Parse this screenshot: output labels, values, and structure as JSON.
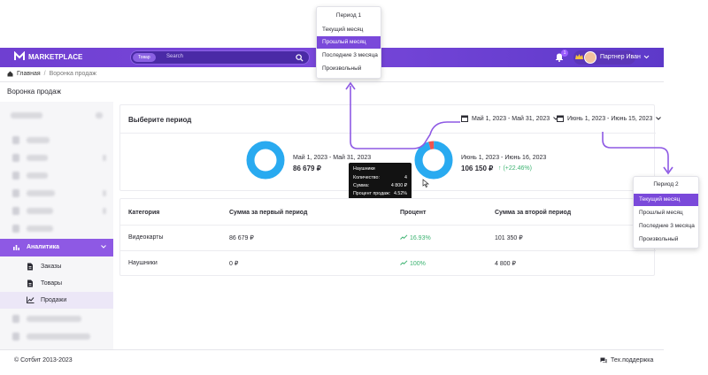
{
  "header": {
    "logo_text": "MARKETPLACE",
    "search_chip": "Товар",
    "search_placeholder": "Search",
    "notification_count": "1",
    "user_name": "Партнер Иван"
  },
  "breadcrumb": {
    "home": "Главная",
    "separator": "/",
    "current": "Воронка продаж"
  },
  "page_title": "Воронка продаж",
  "sidebar": {
    "active_label": "Аналитика",
    "sub_items": [
      {
        "label": "Заказы"
      },
      {
        "label": "Товары"
      },
      {
        "label": "Продажи"
      }
    ]
  },
  "period_card": {
    "title": "Выберите период",
    "period1_select": "Май 1, 2023 - Май 31, 2023",
    "period2_select": "Июнь 1, 2023 - Июнь 15, 2023",
    "stat1": {
      "period": "Май 1, 2023 - Май 31, 2023",
      "value": "86 679 ₽"
    },
    "stat2": {
      "period": "Июнь 1, 2023 - Июнь 16, 2023",
      "value": "106 150 ₽",
      "delta": "(+22.46%)"
    }
  },
  "tooltip": {
    "title": "Наушники",
    "rows": [
      {
        "label": "Количество:",
        "value": "4"
      },
      {
        "label": "Сумма:",
        "value": "4 800 ₽"
      },
      {
        "label": "Процент продаж:",
        "value": "4.52%"
      }
    ]
  },
  "table": {
    "headers": [
      "Категория",
      "Сумма за первый период",
      "Процент",
      "Сумма за второй период"
    ],
    "rows": [
      {
        "category": "Видеокарты",
        "sum1": "86 679 ₽",
        "percent": "16.93%",
        "sum2": "101 350 ₽"
      },
      {
        "category": "Наушники",
        "sum1": "0 ₽",
        "percent": "100%",
        "sum2": "4 800 ₽"
      }
    ]
  },
  "footer": {
    "copyright": "© Сотбит 2013-2023",
    "support": "Тех.поддержка"
  },
  "popup1": {
    "title": "Период 1",
    "items": [
      "Текущий месяц",
      "Прошлый месяц",
      "Последние 3 месяца",
      "Произвольный"
    ],
    "active_index": 1
  },
  "popup2": {
    "title": "Период 2",
    "items": [
      "Текущий месяц",
      "Прошлый месяц",
      "Последние 3 месяца",
      "Произвольный"
    ],
    "active_index": 0
  },
  "chart_data": [
    {
      "type": "pie",
      "categories": [
        "Видеокарты",
        "Наушники"
      ],
      "values": [
        86679,
        0
      ]
    },
    {
      "type": "pie",
      "categories": [
        "Видеокарты",
        "Наушники"
      ],
      "values": [
        101350,
        4800
      ]
    }
  ],
  "colors": {
    "accent": "#7a49da",
    "donut_main": "#29aaf0",
    "donut_secondary": "#f0544f",
    "positive": "#3cb371"
  }
}
